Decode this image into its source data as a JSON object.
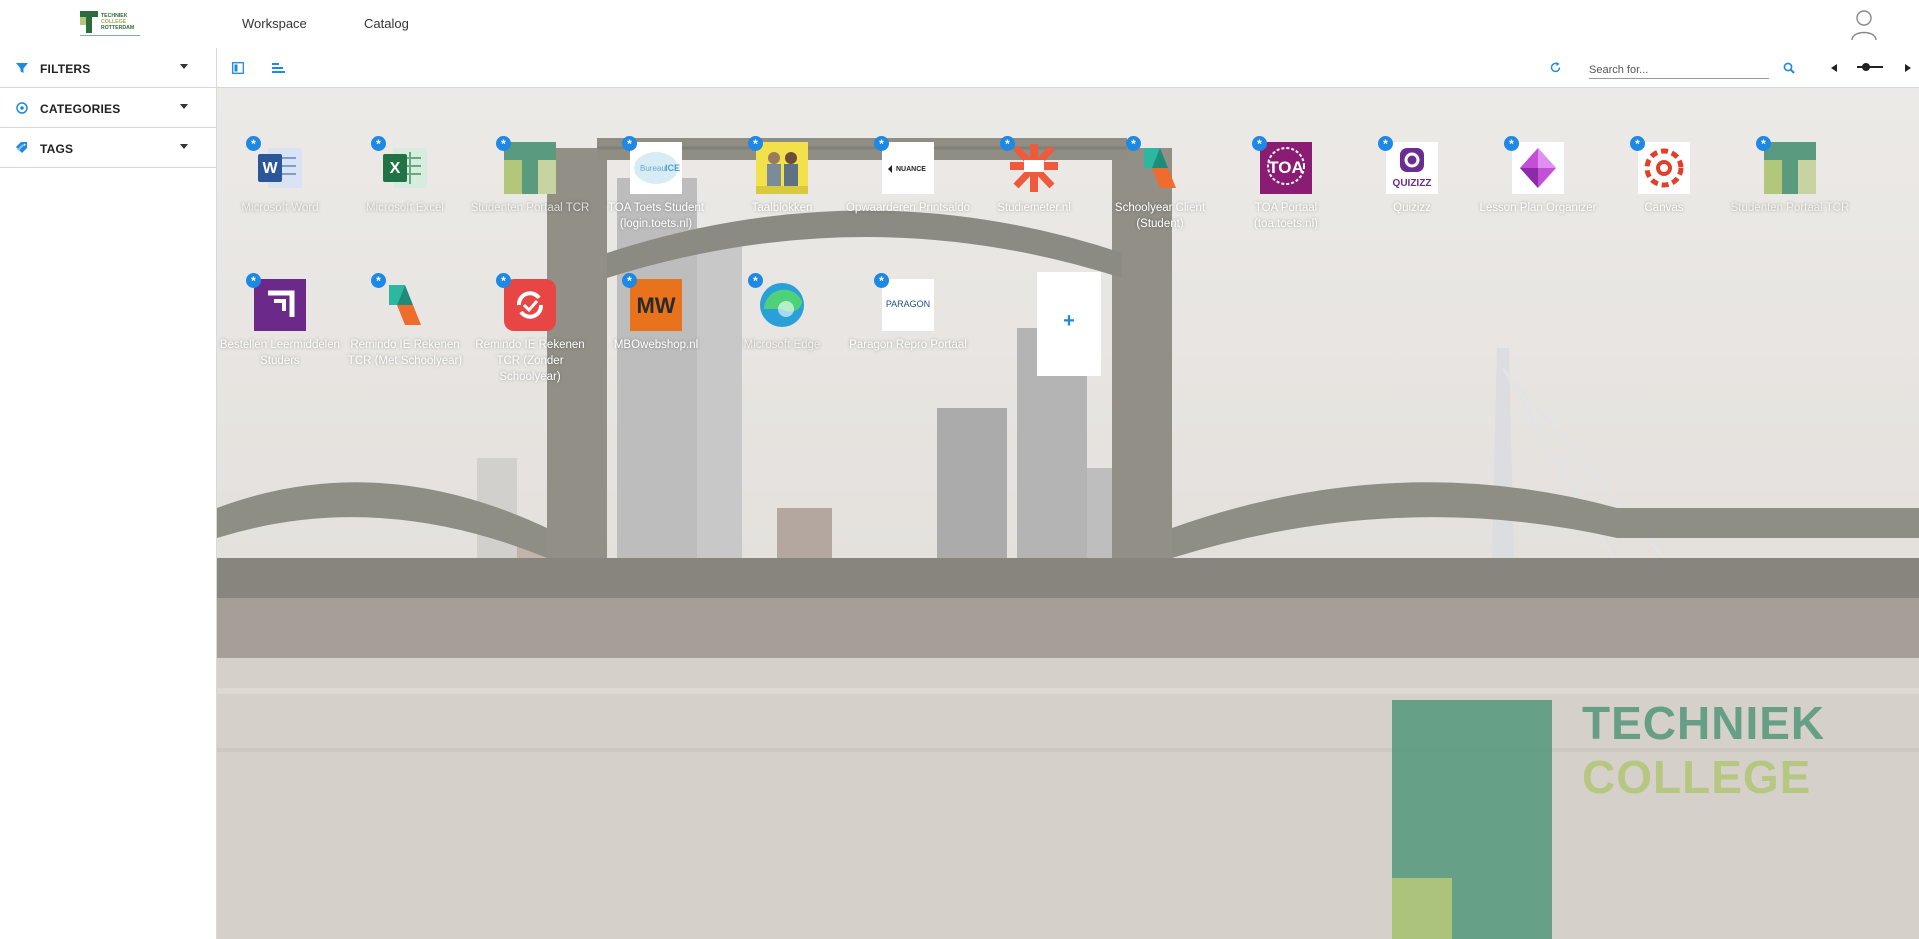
{
  "header": {
    "logo_text": "TECHNIEK COLLEGE ROTTERDAM",
    "nav": [
      "Workspace",
      "Catalog"
    ]
  },
  "sidebar": {
    "items": [
      {
        "label": "FILTERS",
        "icon": "filter-icon"
      },
      {
        "label": "CATEGORIES",
        "icon": "categories-icon"
      },
      {
        "label": "TAGS",
        "icon": "tags-icon"
      }
    ]
  },
  "toolbar": {
    "search_placeholder": "Search for...",
    "icons": [
      "panel-toggle-icon",
      "align-icon",
      "refresh-icon",
      "search-icon",
      "prev-icon",
      "zoom-slider-icon",
      "next-icon"
    ]
  },
  "tiles": [
    {
      "label": "Microsoft Word",
      "icon": "word-icon",
      "dim": true
    },
    {
      "label": "Microsoft Excel",
      "icon": "excel-icon",
      "dim": true
    },
    {
      "label": "Studenten Portaal TCR",
      "icon": "tcr-portal-icon",
      "dim": true
    },
    {
      "label": "TOA Toets Student (login.toets.nl)",
      "icon": "bureau-ice-icon",
      "dim": false
    },
    {
      "label": "Taalblokken",
      "icon": "taalblokken-icon",
      "dim": false
    },
    {
      "label": "Opwaarderen Printsaldo",
      "icon": "nuance-icon",
      "dim": false
    },
    {
      "label": "Studiemeter.nl",
      "icon": "studiemeter-icon",
      "dim": false
    },
    {
      "label": "Schoolyear Client (Student)",
      "icon": "schoolyear-icon",
      "dim": false
    },
    {
      "label": "TOA Portaal (toa.toets.nl)",
      "icon": "toa-icon",
      "dim": false
    },
    {
      "label": "Quizizz",
      "icon": "quizizz-icon",
      "dim": false
    },
    {
      "label": "Lesson Plan Organizer",
      "icon": "lesson-plan-icon",
      "dim": false
    },
    {
      "label": "Canvas",
      "icon": "canvas-icon",
      "dim": false
    },
    {
      "label": "Studenten Portaal TCR",
      "icon": "tcr-portal-icon",
      "dim": true
    },
    {
      "label": "Bestellen Leermiddelen Studers",
      "icon": "bestellen-icon",
      "dim": false
    },
    {
      "label": "Remindo IE Rekenen TCR (Met Schoolyear)",
      "icon": "schoolyear-icon",
      "dim": false
    },
    {
      "label": "Remindo IE Rekenen TCR (Zonder Schoolyear)",
      "icon": "remindo-icon",
      "dim": false
    },
    {
      "label": "MBOwebshop.nl",
      "icon": "mbowebshop-icon",
      "dim": false
    },
    {
      "label": "Microsoft Edge",
      "icon": "edge-icon",
      "dim": true
    },
    {
      "label": "Paragon Repro Portaal",
      "icon": "paragon-icon",
      "dim": false
    }
  ],
  "add_tile": {
    "label": "+"
  },
  "background": {
    "watermark_lines": [
      "TECHNIEK",
      "COLLEGE"
    ],
    "colors": {
      "sky": "#dcd9d6",
      "water": "#c9c2bb",
      "bridge": "#5f5d52",
      "brand_green": "#5a9a7e",
      "brand_lime": "#b3c77a",
      "accent": "#1e88e5"
    }
  }
}
